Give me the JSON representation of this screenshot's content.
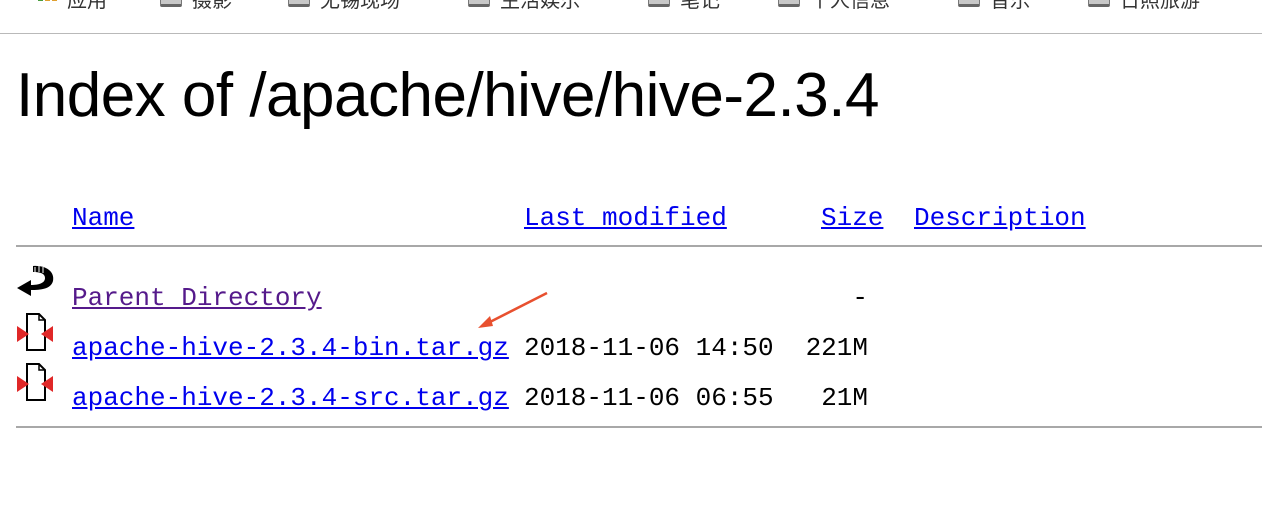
{
  "bookmarks": [
    {
      "label": "应用",
      "icon": "apps-grid-icon"
    },
    {
      "label": "摄影",
      "icon": "folder-icon"
    },
    {
      "label": "无锡现场",
      "icon": "folder-icon"
    },
    {
      "label": "生活娱乐",
      "icon": "folder-icon"
    },
    {
      "label": "笔记",
      "icon": "folder-icon"
    },
    {
      "label": "个人信息",
      "icon": "folder-icon"
    },
    {
      "label": "音乐",
      "icon": "folder-icon"
    },
    {
      "label": "日照旅游",
      "icon": "folder-icon"
    }
  ],
  "title": "Index of /apache/hive/hive-2.3.4",
  "table": {
    "headers": {
      "name": "Name",
      "modified": "Last modified",
      "size": "Size",
      "description": "Description"
    },
    "rows": [
      {
        "name": "Parent Directory",
        "modified": "",
        "size": "-",
        "icon": "back-arrow-icon"
      },
      {
        "name": "apache-hive-2.3.4-bin.tar.gz",
        "modified": "2018-11-06 14:50",
        "size": "221M",
        "icon": "compressed-file-icon"
      },
      {
        "name": "apache-hive-2.3.4-src.tar.gz",
        "modified": "2018-11-06 06:55",
        "size": "21M",
        "icon": "compressed-file-icon"
      }
    ]
  },
  "colors": {
    "link": "#0000ee",
    "visited": "#551a8b",
    "annotation_arrow": "#e8502f"
  }
}
